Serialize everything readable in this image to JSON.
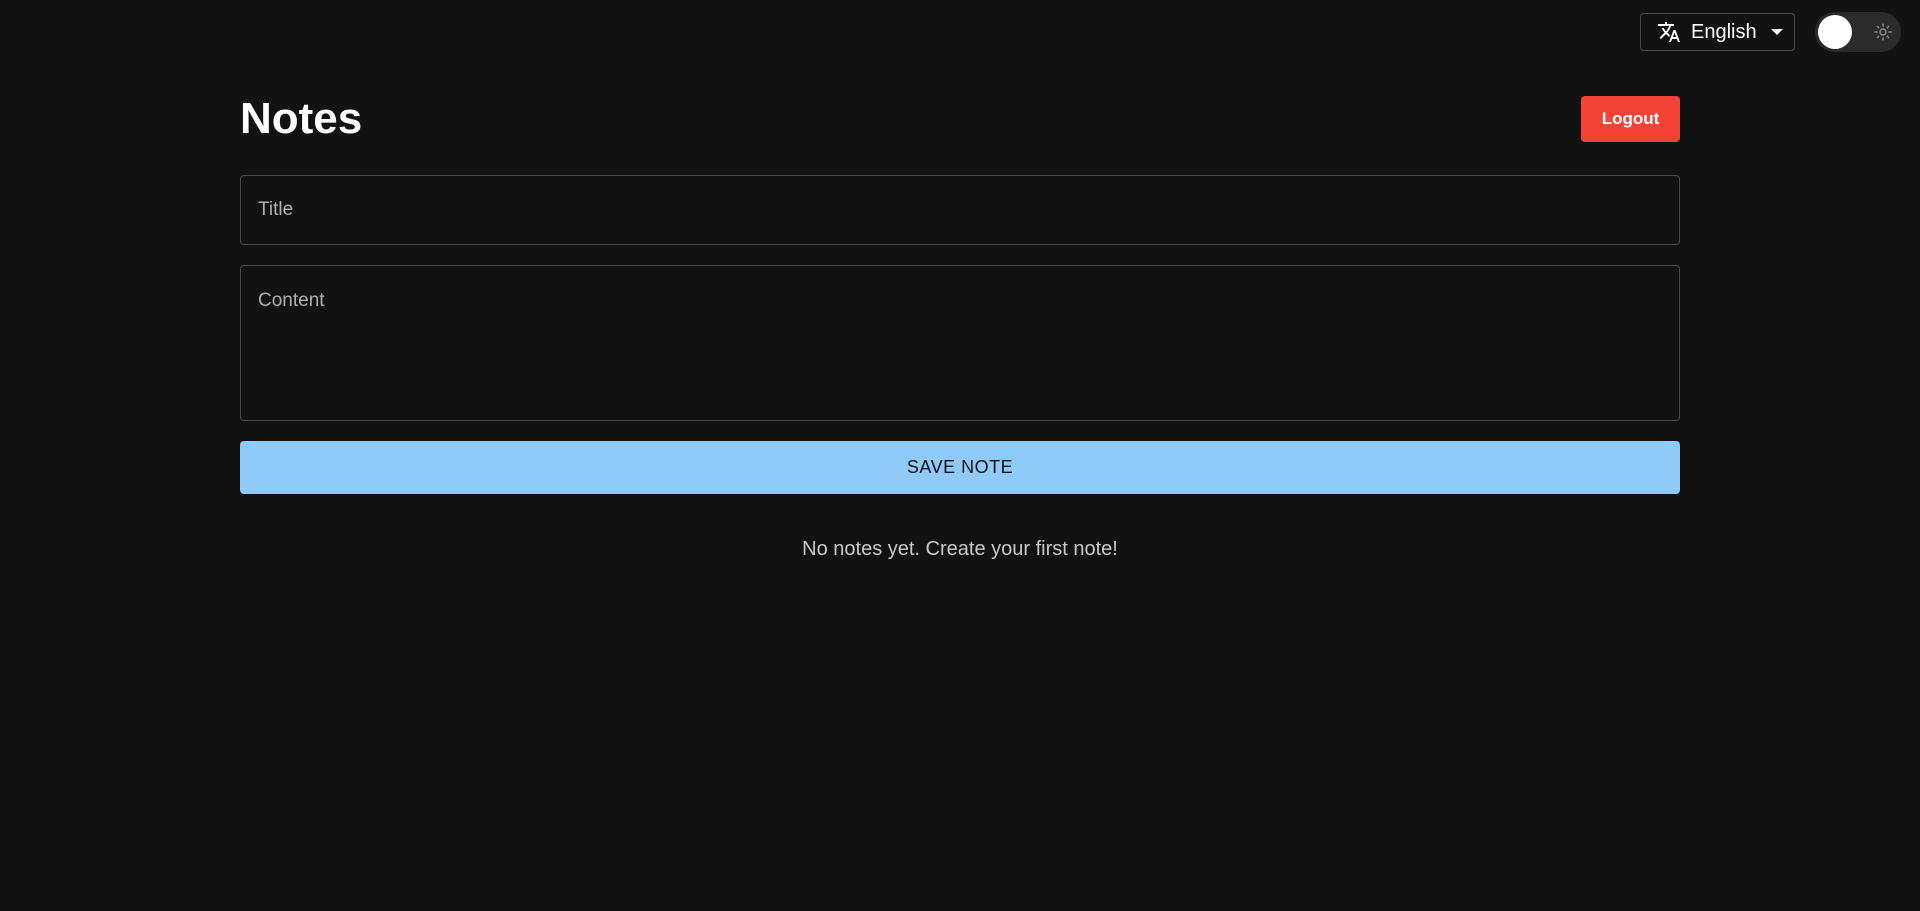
{
  "topbar": {
    "language": {
      "icon": "translate-icon",
      "label": "English",
      "caret_icon": "caret-down-icon"
    },
    "theme_toggle": {
      "icon": "sun-icon",
      "state": "dark"
    }
  },
  "header": {
    "title": "Notes",
    "logout_label": "Logout"
  },
  "form": {
    "title_placeholder": "Title",
    "title_value": "",
    "content_placeholder": "Content",
    "content_value": "",
    "save_label": "SAVE NOTE"
  },
  "notes": {
    "items": [],
    "empty_message": "No notes yet. Create your first note!"
  },
  "colors": {
    "background": "#121212",
    "logout": "#f44336",
    "save": "#90caf9"
  }
}
